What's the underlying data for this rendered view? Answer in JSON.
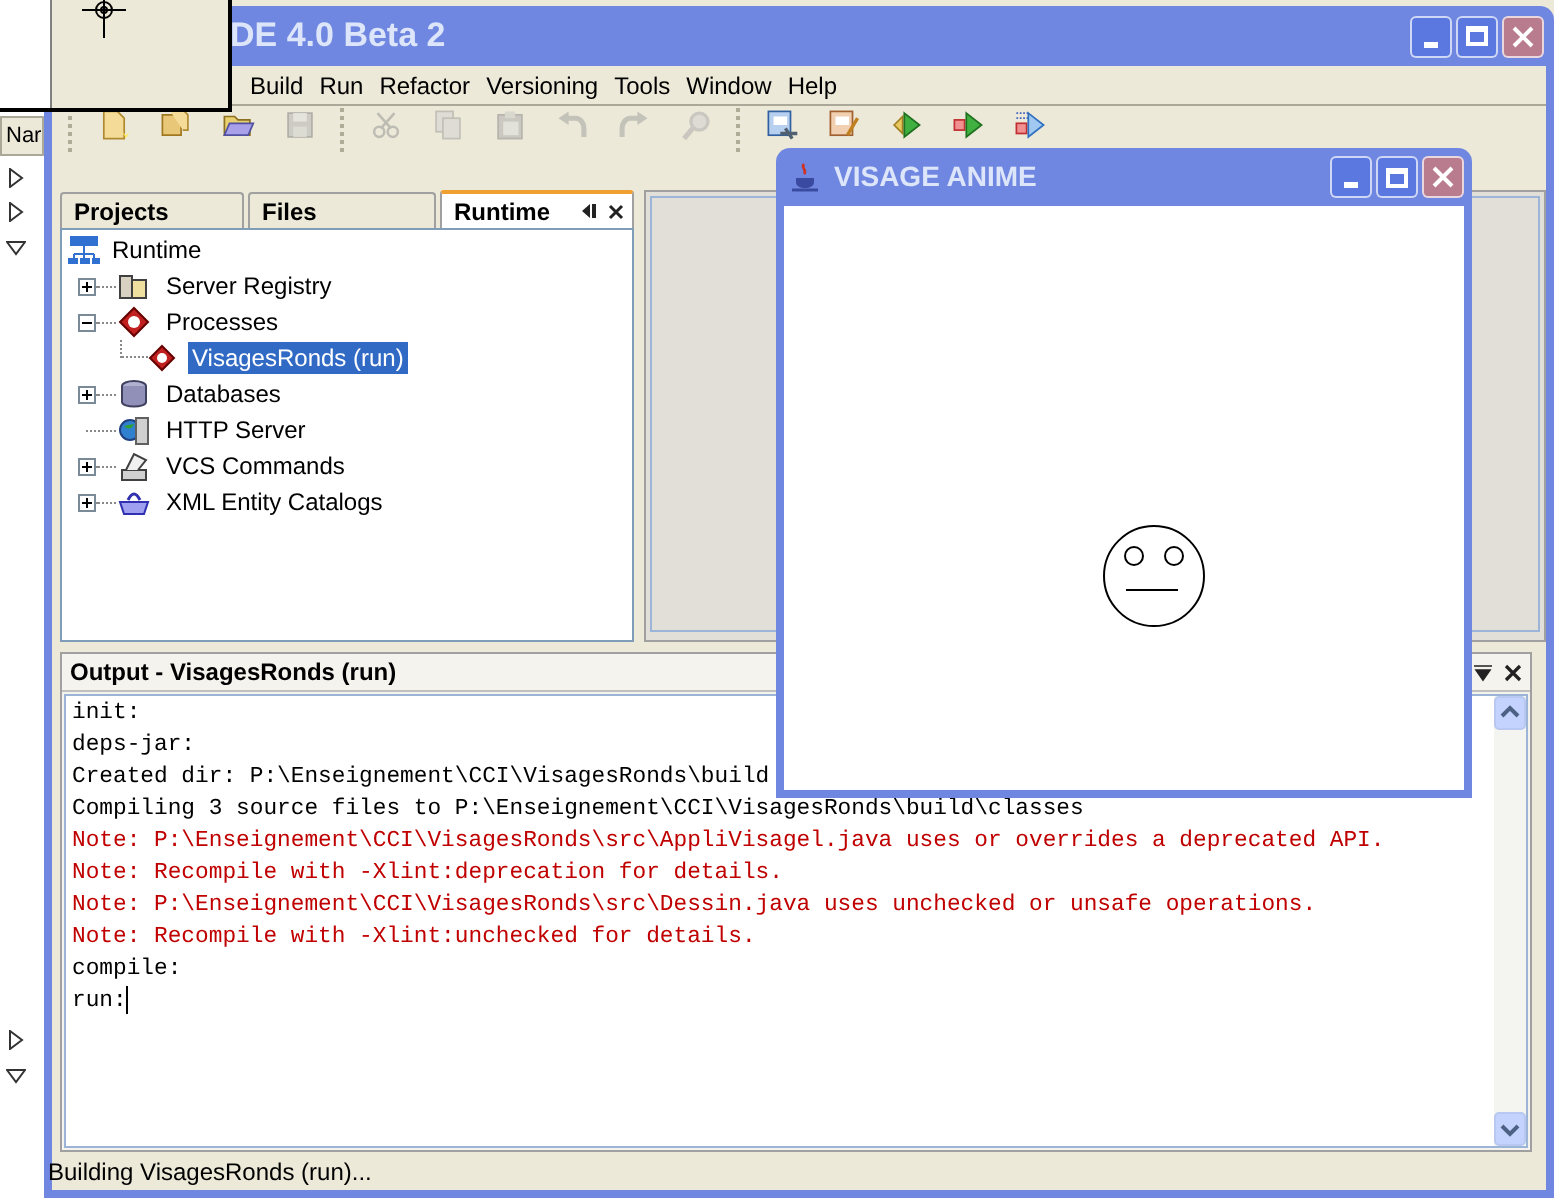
{
  "background_window": {
    "column_header": "Nar",
    "tree_toggles": [
      {
        "expanded": false
      },
      {
        "expanded": false
      },
      {
        "expanded": true
      },
      {
        "expanded": false
      },
      {
        "expanded": true
      }
    ]
  },
  "ide": {
    "title": "DE 4.0 Beta 2",
    "menu": [
      "Build",
      "Run",
      "Refactor",
      "Versioning",
      "Tools",
      "Window",
      "Help"
    ],
    "toolbar": [
      {
        "disabled": false
      },
      {
        "disabled": false
      },
      {
        "disabled": false
      },
      {
        "disabled": true
      },
      {
        "disabled": true
      },
      {
        "disabled": true
      },
      {
        "disabled": true
      },
      {
        "disabled": true
      },
      {
        "disabled": true
      },
      {
        "disabled": true
      },
      {
        "disabled": false
      },
      {
        "disabled": false
      },
      {
        "disabled": false
      },
      {
        "disabled": false
      },
      {
        "disabled": false
      }
    ],
    "tabs": [
      {
        "label": "Projects",
        "selected": false
      },
      {
        "label": "Files",
        "selected": false
      },
      {
        "label": "Runtime",
        "selected": true
      }
    ],
    "tree": [
      {
        "label": "Runtime",
        "kind": "root",
        "selected": false,
        "children": [
          {
            "label": "Server Registry",
            "kind": "folder",
            "expanded": false,
            "selected": false
          },
          {
            "label": "Processes",
            "kind": "folder",
            "expanded": true,
            "selected": false,
            "children": [
              {
                "label": "VisagesRonds (run)",
                "kind": "leaf",
                "selected": true
              }
            ]
          },
          {
            "label": "Databases",
            "kind": "folder",
            "expanded": false,
            "selected": false
          },
          {
            "label": "HTTP Server",
            "kind": "leaf",
            "selected": false
          },
          {
            "label": "VCS Commands",
            "kind": "folder",
            "expanded": false,
            "selected": false
          },
          {
            "label": "XML Entity Catalogs",
            "kind": "folder",
            "expanded": false,
            "selected": false
          }
        ]
      }
    ],
    "output": {
      "title": "Output - VisagesRonds (run)",
      "lines": [
        {
          "kind": "info",
          "text": "init:"
        },
        {
          "kind": "info",
          "text": "deps-jar:"
        },
        {
          "kind": "info",
          "text": "Created dir: P:\\Enseignement\\CCI\\VisagesRonds\\build"
        },
        {
          "kind": "info",
          "text": "Compiling 3 source files to P:\\Enseignement\\CCI\\VisagesRonds\\build\\classes"
        },
        {
          "kind": "note",
          "text": "Note: P:\\Enseignement\\CCI\\VisagesRonds\\src\\AppliVisagel.java uses or overrides a deprecated API."
        },
        {
          "kind": "note",
          "text": "Note: Recompile with -Xlint:deprecation for details."
        },
        {
          "kind": "note",
          "text": "Note: P:\\Enseignement\\CCI\\VisagesRonds\\src\\Dessin.java uses unchecked or unsafe operations."
        },
        {
          "kind": "note",
          "text": "Note: Recompile with -Xlint:unchecked for details."
        },
        {
          "kind": "info",
          "text": "compile:"
        },
        {
          "kind": "info",
          "text": "run:"
        }
      ]
    },
    "status_bar": "Building VisagesRonds (run)..."
  },
  "app_window": {
    "title": "VISAGE ANIME"
  }
}
